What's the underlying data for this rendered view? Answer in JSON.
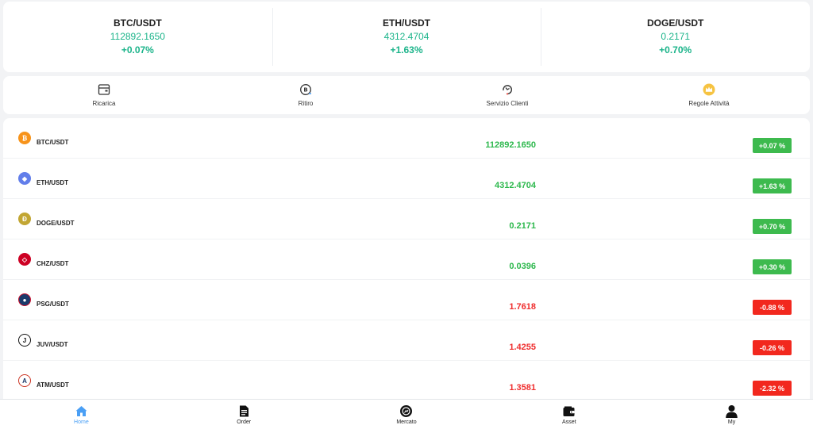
{
  "tickers": [
    {
      "pair": "BTC/USDT",
      "price": "112892.1650",
      "change": "+0.07%"
    },
    {
      "pair": "ETH/USDT",
      "price": "4312.4704",
      "change": "+1.63%"
    },
    {
      "pair": "DOGE/USDT",
      "price": "0.2171",
      "change": "+0.70%"
    }
  ],
  "actions": [
    {
      "label": "Ricarica",
      "icon": "wallet-card-icon"
    },
    {
      "label": "Ritiro",
      "icon": "withdraw-coin-icon"
    },
    {
      "label": "Servizio Clienti",
      "icon": "headset-icon"
    },
    {
      "label": "Regole Attività",
      "icon": "crown-icon"
    }
  ],
  "market": [
    {
      "pair": "BTC/USDT",
      "price": "112892.1650",
      "change": "+0.07 %",
      "direction": "up",
      "icon": "bitcoin-icon",
      "color": "#f7931a"
    },
    {
      "pair": "ETH/USDT",
      "price": "4312.4704",
      "change": "+1.63 %",
      "direction": "up",
      "icon": "ethereum-icon",
      "color": "#627eea"
    },
    {
      "pair": "DOGE/USDT",
      "price": "0.2171",
      "change": "+0.70 %",
      "direction": "up",
      "icon": "dogecoin-icon",
      "color": "#c2a633"
    },
    {
      "pair": "CHZ/USDT",
      "price": "0.0396",
      "change": "+0.30 %",
      "direction": "up",
      "icon": "chiliz-icon",
      "color": "#cd0124"
    },
    {
      "pair": "PSG/USDT",
      "price": "1.7618",
      "change": "-0.88 %",
      "direction": "down",
      "icon": "psg-icon",
      "color": "#1b3a6b"
    },
    {
      "pair": "JUV/USDT",
      "price": "1.4255",
      "change": "-0.26 %",
      "direction": "down",
      "icon": "juventus-icon",
      "color": "#111111"
    },
    {
      "pair": "ATM/USDT",
      "price": "1.3581",
      "change": "-2.32 %",
      "direction": "down",
      "icon": "atletico-icon",
      "color": "#cb3524"
    }
  ],
  "tabs": [
    {
      "label": "Home",
      "icon": "home-icon",
      "active": true
    },
    {
      "label": "Order",
      "icon": "document-icon",
      "active": false
    },
    {
      "label": "Mercato",
      "icon": "market-icon",
      "active": false
    },
    {
      "label": "Asset",
      "icon": "wallet-icon",
      "active": false
    },
    {
      "label": "My",
      "icon": "user-icon",
      "active": false
    }
  ],
  "colors": {
    "up": "#2db84d",
    "down": "#ef2d2d",
    "ticker_green": "#1bb48a",
    "accent": "#4a9ff5"
  }
}
